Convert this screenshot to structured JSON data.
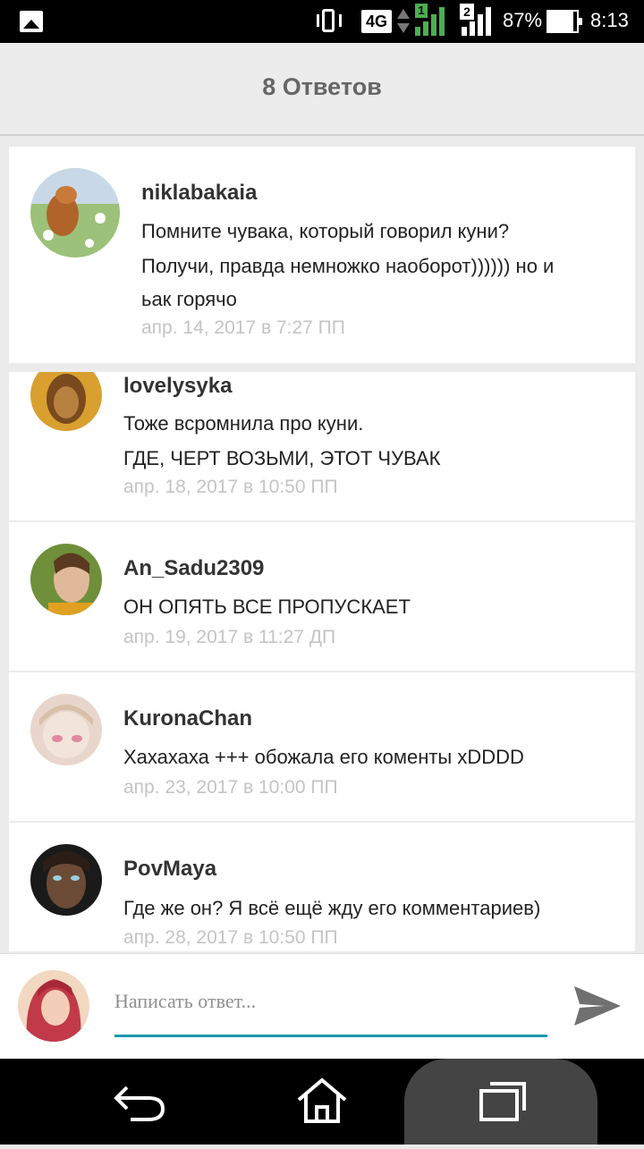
{
  "status_bar": {
    "network": "4G",
    "sim1": "1",
    "sim2": "2",
    "battery_percent": "87%",
    "battery_level": 0.87,
    "time": "8:13",
    "icons": [
      "gallery-icon",
      "vibrate-icon",
      "network-4g-icon",
      "data-arrows-icon",
      "signal-sim1-icon",
      "signal-sim2-icon",
      "battery-icon"
    ]
  },
  "header": {
    "title": "8 Ответов"
  },
  "comments": [
    {
      "username": "niklabakaia",
      "lines": [
        "Помните чувака, который говорил куни?",
        "Получи, правда немножко наоборот)))))) но и",
        "ьак горячо"
      ],
      "date": "апр. 14, 2017 в 7:27 ПП"
    },
    {
      "username": "lovelysyka",
      "lines": [
        "Тоже всромнила про куни.",
        "ГДЕ, ЧЕРТ ВОЗЬМИ,  ЭТОТ ЧУВАК"
      ],
      "date": "апр. 18, 2017 в 10:50 ПП"
    },
    {
      "username": "An_Sadu2309",
      "lines": [
        "ОН ОПЯТЬ ВСЕ ПРОПУСКАЕТ"
      ],
      "date": "апр. 19, 2017 в 11:27 ДП"
    },
    {
      "username": "KuronaChan",
      "lines": [
        "Хахахаха +++ обожала его коменты xDDDD"
      ],
      "date": "апр. 23, 2017 в 10:00 ПП"
    },
    {
      "username": "PovMaya",
      "lines": [
        "Где же он? Я всё ещё жду его комментариев)"
      ],
      "date": "апр. 28, 2017 в 10:50 ПП"
    }
  ],
  "reply": {
    "placeholder": "Написать ответ...",
    "value": "",
    "send_icon": "send-icon"
  },
  "nav": {
    "icons": [
      "back-icon",
      "home-icon",
      "recents-icon"
    ]
  },
  "colors": {
    "accent": "#1b9aaa",
    "date_text": "#c4c4c4",
    "header_text": "#666666",
    "signal_green": "#4caf50"
  }
}
